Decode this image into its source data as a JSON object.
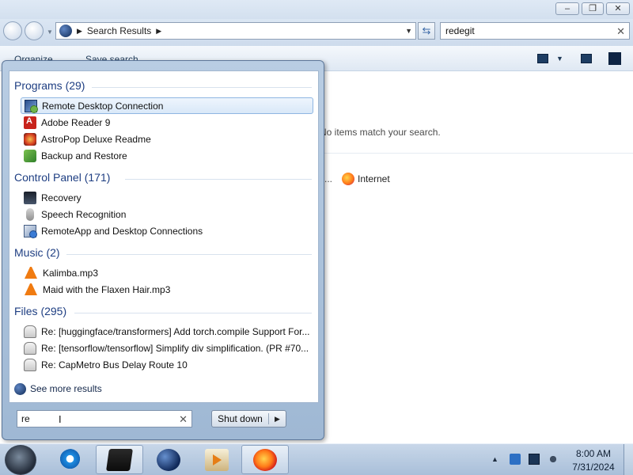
{
  "explorer": {
    "address": {
      "location": "Search Results"
    },
    "search": {
      "value": "redegit"
    },
    "toolbar": {
      "organize": "Organize",
      "save_search": "Save search"
    },
    "content": {
      "no_items": "No items match your search.",
      "location_label": "Internet"
    }
  },
  "start_menu": {
    "groups": [
      {
        "title": "Programs (29)",
        "items": [
          {
            "label": "Remote Desktop Connection",
            "icon": "remote-desktop-icon"
          },
          {
            "label": "Adobe Reader 9",
            "icon": "pdf-icon"
          },
          {
            "label": "AstroPop Deluxe Readme",
            "icon": "astropop-icon"
          },
          {
            "label": "Backup and Restore",
            "icon": "backup-icon"
          }
        ]
      },
      {
        "title": "Control Panel (171)",
        "items": [
          {
            "label": "Recovery",
            "icon": "recovery-icon"
          },
          {
            "label": "Speech Recognition",
            "icon": "microphone-icon"
          },
          {
            "label": "RemoteApp and Desktop Connections",
            "icon": "remoteapp-icon"
          }
        ]
      },
      {
        "title": "Music (2)",
        "items": [
          {
            "label": "Kalimba.mp3",
            "icon": "vlc-icon"
          },
          {
            "label": "Maid with the Flaxen Hair.mp3",
            "icon": "vlc-icon"
          }
        ]
      },
      {
        "title": "Files (295)",
        "items": [
          {
            "label": "Re: [huggingface/transformers] Add torch.compile Support For...",
            "icon": "mail-icon"
          },
          {
            "label": "Re: [tensorflow/tensorflow] Simplify div simplification. (PR #70...",
            "icon": "mail-icon"
          },
          {
            "label": "Re: CapMetro Bus Delay Route 10",
            "icon": "mail-icon"
          }
        ]
      }
    ],
    "see_more": "See more results",
    "search_value": "re",
    "shutdown_label": "Shut down"
  },
  "taskbar": {
    "clock_time": "8:00 AM",
    "clock_date": "7/31/2024",
    "apps": [
      "internet-explorer",
      "windows-explorer",
      "globe-app",
      "media-player",
      "firefox"
    ]
  }
}
